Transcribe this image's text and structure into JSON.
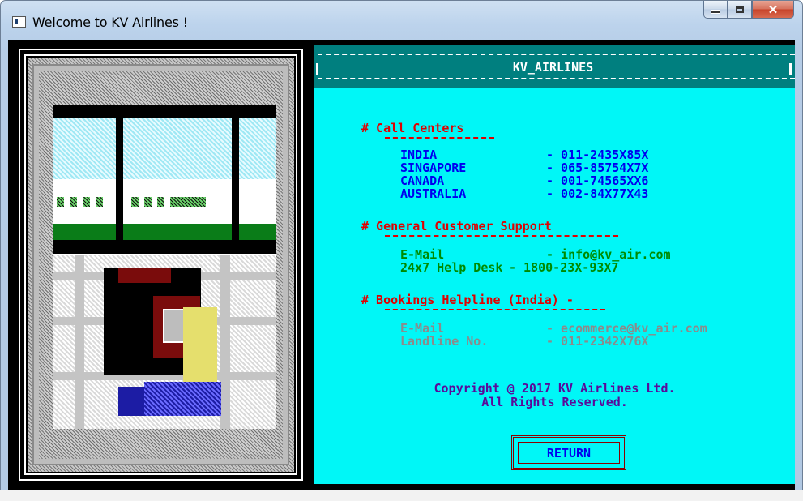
{
  "window": {
    "title": "Welcome to KV Airlines !"
  },
  "header": {
    "title": "KV_AIRLINES"
  },
  "sections": {
    "call_centers": {
      "heading": "# Call Centers",
      "rows": [
        {
          "country": "INDIA",
          "number": "- 011-2435X85X"
        },
        {
          "country": "SINGAPORE",
          "number": "- 065-85754X7X"
        },
        {
          "country": "CANADA",
          "number": "- 001-74565XX6"
        },
        {
          "country": "AUSTRALIA",
          "number": "- 002-84X77X43"
        }
      ]
    },
    "general_support": {
      "heading": "# General Customer Support",
      "email_label": "E-Mail",
      "email_value": "- info@kv_air.com",
      "helpdesk_label": "24x7 Help Desk",
      "helpdesk_value": "- 1800-23X-93X7"
    },
    "bookings": {
      "heading": "# Bookings Helpline (India) -",
      "email_label": "E-Mail",
      "email_value": "- ecommerce@kv_air.com",
      "landline_label": "Landline No.",
      "landline_value": "- 011-2342X76X"
    }
  },
  "copyright": {
    "line1": "Copyright @ 2017 KV Airlines Ltd.",
    "line2": "All Rights Reserved."
  },
  "return_button": "RETURN",
  "colors": {
    "panel_bg": "#00f7f7",
    "header_bg": "#007f7f",
    "heading_red": "#e00000",
    "text_blue": "#0000ee",
    "text_green": "#008a00",
    "text_grey": "#8b8b8b",
    "text_purple": "#5a0a9a"
  }
}
